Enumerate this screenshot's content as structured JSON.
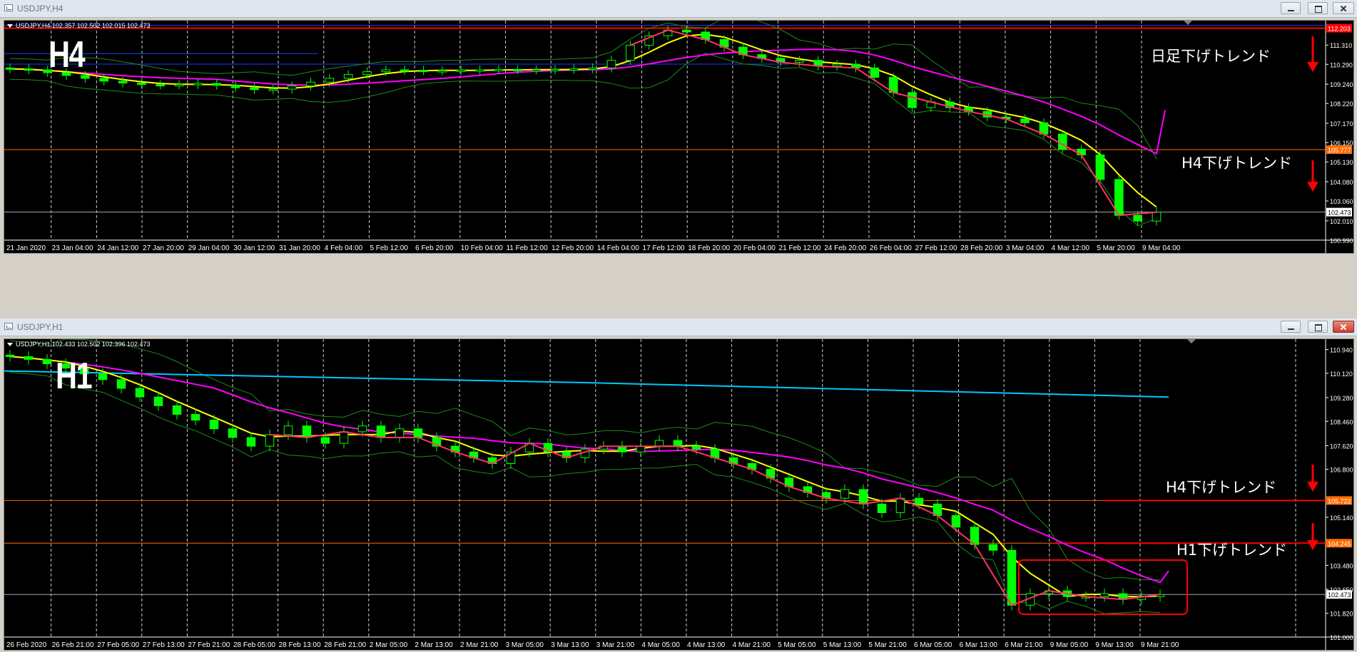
{
  "colors": {
    "background": "#000000",
    "bull_candle": "#00ff00",
    "ma_fast": "#ffff00",
    "ma_slow": "#ff00ff",
    "ma_long": "#00c8ff",
    "bollinger": "#1c8c1c",
    "zigzag": "#ff3366",
    "resistance": "#ff0000",
    "level_orange": "#ff6a00",
    "level_blue": "#1a3cff",
    "last_price": "#a0a8b8"
  },
  "windows": [
    {
      "title": "USDJPY,H4",
      "symbol_info": "USDJPY,H4  102.357 102.502 102.015 102.473",
      "timeframe_label": "H4",
      "price_scale": [
        "112.203",
        "111.310",
        "110.290",
        "109.240",
        "108.220",
        "107.170",
        "106.150",
        "105.777",
        "105.130",
        "104.080",
        "103.060",
        "102.473",
        "102.010",
        "100.990"
      ],
      "time_labels": [
        "21 Jan 2020",
        "23 Jan 04:00",
        "24 Jan 12:00",
        "27 Jan 20:00",
        "29 Jan 04:00",
        "30 Jan 12:00",
        "31 Jan 20:00",
        "4 Feb 04:00",
        "5 Feb 12:00",
        "6 Feb 20:00",
        "10 Feb 04:00",
        "11 Feb 12:00",
        "12 Feb 20:00",
        "14 Feb 04:00",
        "17 Feb 12:00",
        "18 Feb 20:00",
        "20 Feb 04:00",
        "21 Feb 12:00",
        "24 Feb 20:00",
        "26 Feb 04:00",
        "27 Feb 12:00",
        "28 Feb 20:00",
        "3 Mar 04:00",
        "4 Mar 12:00",
        "5 Mar 20:00",
        "9 Mar 04:00"
      ],
      "annotations": [
        {
          "text": "日足下げトレンド",
          "level": "112.203"
        },
        {
          "text": "H4下げトレンド",
          "level": "105.777"
        }
      ],
      "chart_data": {
        "type": "candlestick",
        "instrument": "USDJPY",
        "timeframe": "H4",
        "ohlc_last": {
          "open": 102.357,
          "high": 102.502,
          "low": 102.015,
          "close": 102.473
        },
        "ylim": [
          100.99,
          112.6
        ],
        "horizontal_levels": [
          {
            "price": 112.203,
            "color": "red"
          },
          {
            "price": 105.777,
            "color": "orange"
          },
          {
            "price": 102.473,
            "color": "gray"
          }
        ],
        "close_series": [
          110.05,
          110.0,
          109.85,
          109.7,
          109.55,
          109.4,
          109.3,
          109.22,
          109.2,
          109.22,
          109.28,
          109.18,
          109.05,
          108.95,
          108.98,
          109.15,
          109.35,
          109.55,
          109.75,
          109.9,
          110.0,
          109.98,
          109.95,
          109.96,
          109.98,
          110.0,
          110.02,
          110.0,
          110.0,
          110.02,
          110.05,
          110.1,
          110.5,
          111.3,
          111.8,
          112.1,
          112.0,
          111.6,
          111.2,
          110.8,
          110.6,
          110.4,
          110.5,
          110.2,
          110.3,
          110.1,
          109.6,
          108.8,
          108.0,
          108.3,
          108.0,
          107.8,
          107.5,
          107.4,
          107.2,
          106.6,
          105.8,
          105.5,
          104.2,
          102.3,
          102.0,
          102.47
        ]
      }
    },
    {
      "title": "USDJPY,H1",
      "symbol_info": "USDJPY,H1  102.433 102.502 102.396 102.473",
      "timeframe_label": "H1",
      "price_scale": [
        "110.940",
        "110.120",
        "109.280",
        "108.460",
        "107.620",
        "106.800",
        "105.722",
        "105.140",
        "104.245",
        "103.480",
        "102.650",
        "102.473",
        "101.820",
        "101.000"
      ],
      "time_labels": [
        "26 Feb 2020",
        "26 Feb 21:00",
        "27 Feb 05:00",
        "27 Feb 13:00",
        "27 Feb 21:00",
        "28 Feb 05:00",
        "28 Feb 13:00",
        "28 Feb 21:00",
        "2 Mar 05:00",
        "2 Mar 13:00",
        "2 Mar 21:00",
        "3 Mar 05:00",
        "3 Mar 13:00",
        "3 Mar 21:00",
        "4 Mar 05:00",
        "4 Mar 13:00",
        "4 Mar 21:00",
        "5 Mar 05:00",
        "5 Mar 13:00",
        "5 Mar 21:00",
        "6 Mar 05:00",
        "6 Mar 13:00",
        "6 Mar 21:00",
        "9 Mar 05:00",
        "9 Mar 13:00",
        "9 Mar 21:00"
      ],
      "annotations": [
        {
          "text": "H4下げトレンド",
          "level": "105.722"
        },
        {
          "text": "H1下げトレンド",
          "level": "104.245"
        }
      ],
      "chart_data": {
        "type": "candlestick",
        "instrument": "USDJPY",
        "timeframe": "H1",
        "ohlc_last": {
          "open": 102.433,
          "high": 102.502,
          "low": 102.396,
          "close": 102.473
        },
        "ylim": [
          101.0,
          111.3
        ],
        "horizontal_levels": [
          {
            "price": 105.722,
            "color": "orange"
          },
          {
            "price": 104.245,
            "color": "orange"
          },
          {
            "price": 102.473,
            "color": "gray"
          }
        ],
        "close_series": [
          110.7,
          110.6,
          110.45,
          110.3,
          110.1,
          109.9,
          109.6,
          109.3,
          109.0,
          108.7,
          108.5,
          108.2,
          107.9,
          107.6,
          108.0,
          108.3,
          107.9,
          107.7,
          108.1,
          108.3,
          107.9,
          108.2,
          107.9,
          107.6,
          107.4,
          107.2,
          107.0,
          107.4,
          107.7,
          107.4,
          107.2,
          107.5,
          107.6,
          107.4,
          107.6,
          107.8,
          107.6,
          107.5,
          107.2,
          107.0,
          106.8,
          106.5,
          106.2,
          106.0,
          105.8,
          106.1,
          105.6,
          105.3,
          105.8,
          105.6,
          105.2,
          104.8,
          104.2,
          104.0,
          102.1,
          102.5,
          102.6,
          102.4,
          102.4,
          102.5,
          102.3,
          102.4,
          102.47
        ]
      }
    }
  ]
}
